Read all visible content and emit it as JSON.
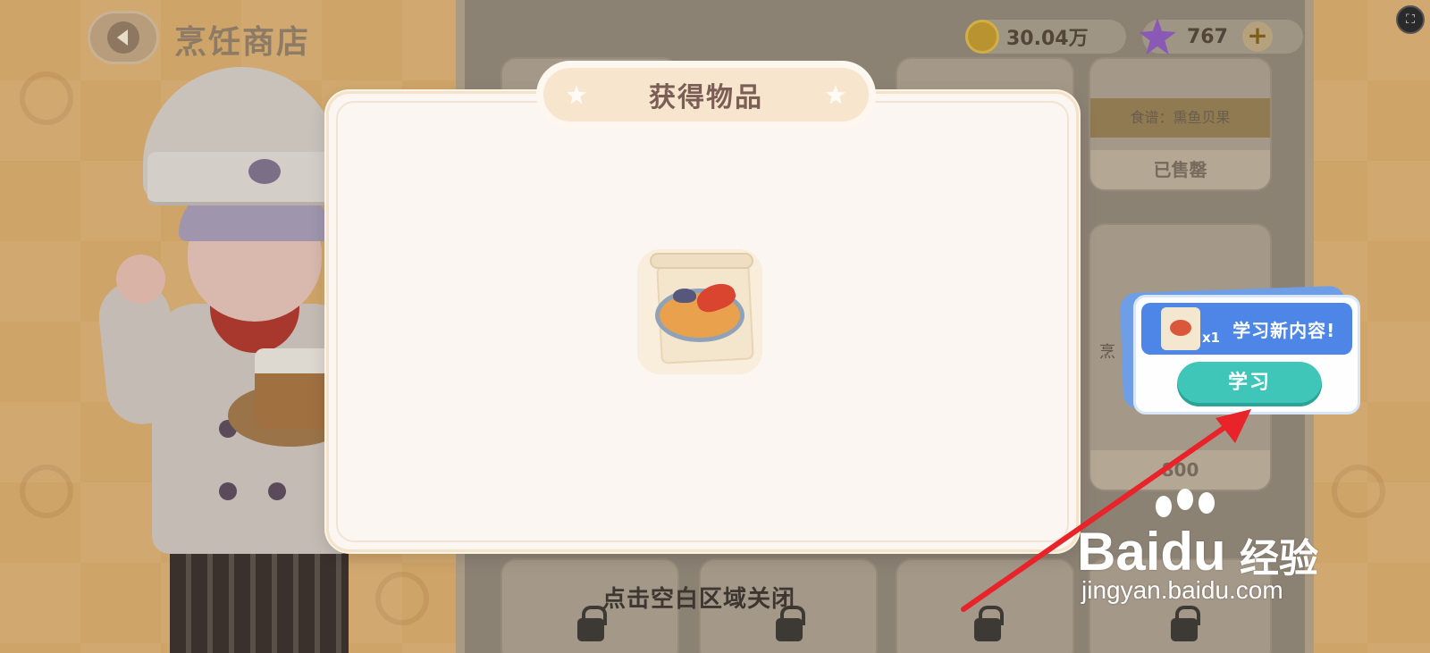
{
  "header": {
    "title": "烹饪商店",
    "coins": "30.04万",
    "stars": "767",
    "plus_label": "+"
  },
  "shop": {
    "card_recipe_label": "食谱：熏鱼贝果",
    "card_status": "已售罄",
    "card_partial_char": "烹",
    "card_price": "800"
  },
  "modal": {
    "title": "获得物品",
    "close_hint": "点击空白区域关闭"
  },
  "learn_popup": {
    "quantity": "x1",
    "message": "学习新内容!",
    "button_label": "学习"
  },
  "watermark": {
    "brand": "Bai",
    "brand_du": "du",
    "brand_cn": "经验",
    "url": "jingyan.baidu.com"
  },
  "colors": {
    "accent_learn_button": "#3fc6b8",
    "popup_blue": "#4d86e6",
    "modal_bg": "#fbf6f1",
    "annotation_arrow": "#e8232a"
  }
}
